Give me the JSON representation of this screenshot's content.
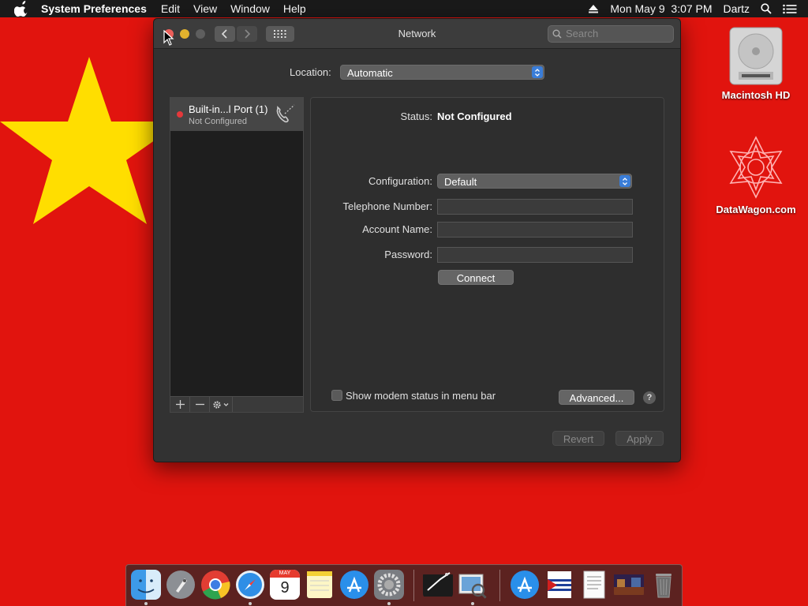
{
  "menubar": {
    "app_name": "System Preferences",
    "items": [
      "Edit",
      "View",
      "Window",
      "Help"
    ],
    "clock": "Mon May 9  3:07 PM",
    "user": "Dartz"
  },
  "desktop": {
    "icons": [
      {
        "label": "Macintosh HD",
        "icon": "hard-drive-icon"
      },
      {
        "label": "DataWagon.com",
        "icon": "red-mandala-icon"
      }
    ],
    "background_color": "#e1140e",
    "star_color": "#ffde00"
  },
  "window": {
    "title": "Network",
    "search_placeholder": "Search",
    "location_label": "Location:",
    "location_value": "Automatic",
    "services": [
      {
        "name": "Built-in...l Port (1)",
        "status": "Not Configured",
        "icon": "telephone-modem-icon",
        "status_color": "#e5383b"
      }
    ],
    "detail": {
      "status_label": "Status:",
      "status_value": "Not Configured",
      "configuration_label": "Configuration:",
      "configuration_value": "Default",
      "telephone_label": "Telephone Number:",
      "telephone_value": "",
      "account_label": "Account Name:",
      "account_value": "",
      "password_label": "Password:",
      "password_value": "",
      "connect_label": "Connect",
      "modem_status_label": "Show modem status in menu bar",
      "advanced_label": "Advanced...",
      "help_label": "?"
    },
    "revert_label": "Revert",
    "apply_label": "Apply"
  },
  "dock": {
    "apps": [
      "Finder",
      "Launchpad",
      "Chrome",
      "Safari",
      "Calendar",
      "Notes",
      "App Store",
      "System Preferences",
      "Terminal",
      "Preview",
      "App Store",
      "Cuba Flag",
      "Document",
      "Photo",
      "Trash"
    ],
    "calendar_month": "MAY",
    "calendar_day": "9"
  }
}
